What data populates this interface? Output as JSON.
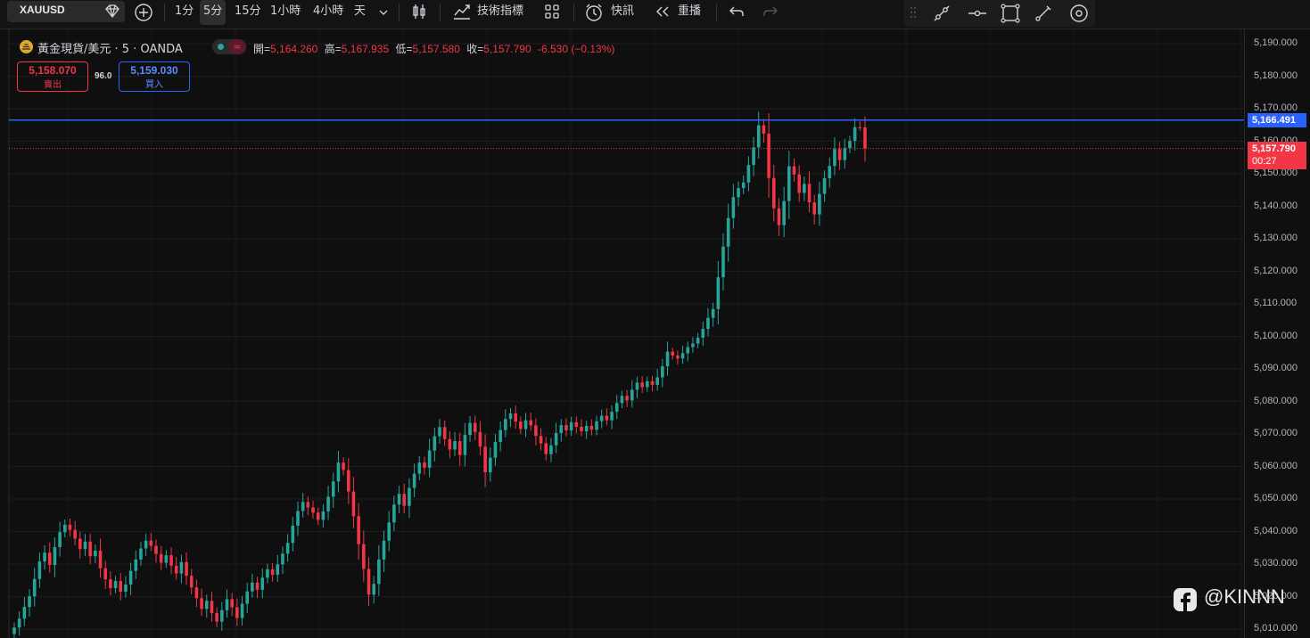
{
  "toolbar": {
    "symbol": "XAUUSD",
    "timeframes": [
      "1分",
      "5分",
      "15分",
      "1小時",
      "4小時",
      "天"
    ],
    "active_timeframe": "5分",
    "indicators_label": "技術指標",
    "alerts_label": "快訊",
    "replay_label": "重播"
  },
  "legend": {
    "title": "黃金現貨/美元 · 5 · OANDA",
    "open_key": "開=",
    "open": "5,164.260",
    "high_key": "高=",
    "high": "5,167.935",
    "low_key": "低=",
    "low": "5,157.580",
    "close_key": "收=",
    "close": "5,157.790",
    "change": "-6.530 (−0.13%)"
  },
  "trade": {
    "sell_price": "5,158.070",
    "sell_label": "賣出",
    "spread": "96.0",
    "buy_price": "5,159.030",
    "buy_label": "買入"
  },
  "price_axis": {
    "ticks": [
      "5,190.000",
      "5,180.000",
      "5,170.000",
      "5,160.000",
      "5,150.000",
      "5,140.000",
      "5,130.000",
      "5,120.000",
      "5,110.000",
      "5,100.000",
      "5,090.000",
      "5,080.000",
      "5,070.000",
      "5,060.000",
      "5,050.000",
      "5,040.000",
      "5,030.000",
      "5,020.000",
      "5,010.000"
    ],
    "hline_price": "5,166.491",
    "last_price": "5,157.790",
    "countdown": "00:27"
  },
  "colors": {
    "up": "#26a69a",
    "down": "#f23645",
    "hline": "#2962ff"
  },
  "watermark": "@KINNN",
  "chart_data": {
    "type": "candlestick",
    "ylim": [
      5007,
      5195
    ],
    "hline": 5166.491,
    "last": 5157.79,
    "closes": [
      5010.5,
      5013.2,
      5016.8,
      5020.1,
      5025.4,
      5030.8,
      5033.5,
      5029.7,
      5035.2,
      5039.8,
      5042.1,
      5040.5,
      5037.8,
      5034.6,
      5036.9,
      5032.4,
      5034.1,
      5028.7,
      5025.3,
      5022.6,
      5024.8,
      5021.5,
      5023.7,
      5027.9,
      5031.4,
      5034.8,
      5037.2,
      5035.6,
      5033.1,
      5030.4,
      5032.7,
      5029.5,
      5027.1,
      5030.6,
      5026.4,
      5022.8,
      5019.5,
      5016.2,
      5018.7,
      5014.9,
      5012.3,
      5015.8,
      5019.2,
      5016.7,
      5013.4,
      5017.8,
      5021.6,
      5024.3,
      5022.1,
      5025.8,
      5028.4,
      5026.7,
      5029.9,
      5033.2,
      5036.5,
      5041.8,
      5046.3,
      5049.1,
      5047.4,
      5045.8,
      5043.6,
      5046.2,
      5050.7,
      5055.4,
      5061.2,
      5058.9,
      5052.3,
      5044.7,
      5036.1,
      5028.5,
      5020.6,
      5023.9,
      5031.4,
      5037.2,
      5042.8,
      5048.3,
      5051.6,
      5047.9,
      5053.4,
      5057.8,
      5061.2,
      5059.6,
      5064.9,
      5069.3,
      5072.1,
      5068.4,
      5065.2,
      5067.8,
      5063.5,
      5069.7,
      5073.4,
      5070.6,
      5066.1,
      5058.2,
      5062.7,
      5067.5,
      5071.2,
      5074.6,
      5076.3,
      5073.8,
      5071.5,
      5074.2,
      5072.6,
      5069.4,
      5067.1,
      5063.8,
      5066.5,
      5070.3,
      5072.7,
      5071.1,
      5073.6,
      5072.2,
      5070.8,
      5072.5,
      5071.3,
      5073.9,
      5075.6,
      5074.2,
      5076.8,
      5079.5,
      5081.7,
      5080.3,
      5083.6,
      5085.8,
      5084.4,
      5086.2,
      5085.1,
      5087.4,
      5090.8,
      5095.3,
      5094.1,
      5093.2,
      5094.8,
      5096.7,
      5097.8,
      5099.6,
      5102.3,
      5105.7,
      5108.4,
      5118.2,
      5127.6,
      5136.4,
      5142.8,
      5145.6,
      5147.3,
      5152.7,
      5158.1,
      5164.9,
      5162.3,
      5148.7,
      5139.4,
      5134.2,
      5141.6,
      5152.3,
      5149.8,
      5144.1,
      5146.9,
      5141.2,
      5137.5,
      5143.8,
      5148.6,
      5152.4,
      5157.6,
      5154.2,
      5157.9,
      5160.1,
      5164.3,
      5164.26,
      5157.79
    ]
  }
}
